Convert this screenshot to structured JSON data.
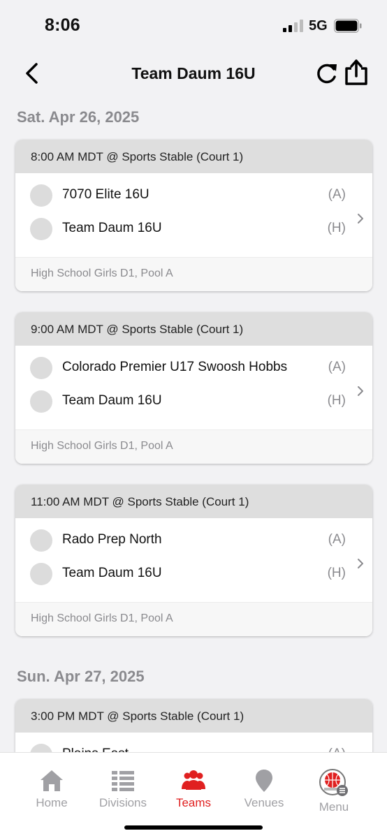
{
  "status_bar": {
    "time": "8:06",
    "network": "5G"
  },
  "nav": {
    "title": "Team Daum 16U",
    "back_icon": "chevron-left-icon",
    "refresh_icon": "refresh-icon",
    "share_icon": "share-icon"
  },
  "days": [
    {
      "date": "Sat. Apr 26, 2025",
      "games": [
        {
          "time": "8:00 AM MDT @ Sports Stable (Court 1)",
          "teams": [
            {
              "name": "7070 Elite 16U",
              "tag": "(A)"
            },
            {
              "name": "Team Daum 16U",
              "tag": "(H)"
            }
          ],
          "division": "High School Girls D1, Pool A"
        },
        {
          "time": "9:00 AM MDT @ Sports Stable (Court 1)",
          "teams": [
            {
              "name": "Colorado Premier U17 Swoosh Hobbs",
              "tag": "(A)"
            },
            {
              "name": "Team Daum 16U",
              "tag": "(H)"
            }
          ],
          "division": "High School Girls D1, Pool A"
        },
        {
          "time": "11:00 AM MDT @ Sports Stable (Court 1)",
          "teams": [
            {
              "name": "Rado Prep North",
              "tag": "(A)"
            },
            {
              "name": "Team Daum 16U",
              "tag": "(H)"
            }
          ],
          "division": "High School Girls D1, Pool A"
        }
      ]
    },
    {
      "date": "Sun. Apr 27, 2025",
      "games": [
        {
          "time": "3:00 PM MDT @ Sports Stable (Court 1)",
          "teams": [
            {
              "name": "Plains East",
              "tag": "(A)"
            }
          ]
        }
      ]
    }
  ],
  "tabs": [
    {
      "label": "Home",
      "icon": "home-icon",
      "active": false
    },
    {
      "label": "Divisions",
      "icon": "divisions-icon",
      "active": false
    },
    {
      "label": "Teams",
      "icon": "teams-icon",
      "active": true
    },
    {
      "label": "Venues",
      "icon": "venue-pin-icon",
      "active": false
    },
    {
      "label": "Menu",
      "icon": "menu-logo-icon",
      "active": false
    }
  ],
  "colors": {
    "accent": "#e02020",
    "background": "#f2f2f4",
    "card_header": "#dedede",
    "muted_text": "#8a8a8e"
  }
}
